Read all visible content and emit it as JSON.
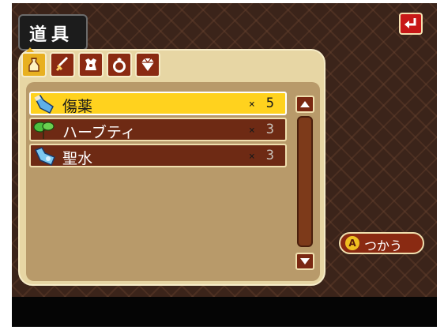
{
  "header": {
    "title": "道具"
  },
  "category_tabs": [
    {
      "name": "items",
      "icon": "bag-icon",
      "active": true
    },
    {
      "name": "weapons",
      "icon": "sword-icon",
      "active": false
    },
    {
      "name": "armor",
      "icon": "armor-icon",
      "active": false
    },
    {
      "name": "accessories",
      "icon": "ring-icon",
      "active": false
    },
    {
      "name": "valuables",
      "icon": "gem-icon",
      "active": false
    }
  ],
  "items": [
    {
      "name": "傷薬",
      "prefix": "×",
      "count": "5",
      "icon": "potion-icon",
      "selected": true
    },
    {
      "name": "ハーブティ",
      "prefix": "×",
      "count": "3",
      "icon": "herb-icon",
      "selected": false
    },
    {
      "name": "聖水",
      "prefix": "×",
      "count": "3",
      "icon": "holy-water-icon",
      "selected": false
    }
  ],
  "use_button": {
    "key": "A",
    "label": "つかう"
  },
  "colors": {
    "background": "#3b241a",
    "panel": "#e7d6a4",
    "row": "#6e2a14",
    "selected_row": "#ffd21e",
    "accent_red": "#c81818"
  }
}
